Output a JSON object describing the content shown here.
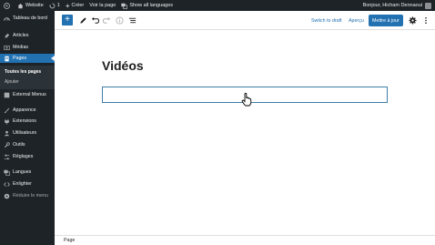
{
  "adminbar": {
    "site": "Website",
    "updates": "1",
    "create": "Créer",
    "view": "Voir la page",
    "languages": "Show all languages",
    "greeting": "Bonjour, Hicham Dennaoui"
  },
  "sidebar": {
    "items": [
      {
        "label": "Tableau de bord",
        "icon": "dashboard-icon"
      },
      {
        "label": "Articles",
        "icon": "pin-icon"
      },
      {
        "label": "Médias",
        "icon": "media-icon"
      },
      {
        "label": "Pages",
        "icon": "pages-icon"
      },
      {
        "label": "External Menus",
        "icon": "menu-icon"
      },
      {
        "label": "Apparence",
        "icon": "brush-icon"
      },
      {
        "label": "Extensions",
        "icon": "plugin-icon"
      },
      {
        "label": "Utilisateurs",
        "icon": "users-icon"
      },
      {
        "label": "Outils",
        "icon": "tools-icon"
      },
      {
        "label": "Réglages",
        "icon": "settings-icon"
      },
      {
        "label": "Langues",
        "icon": "languages-icon"
      },
      {
        "label": "Enlighter",
        "icon": "code-icon"
      },
      {
        "label": "Réduire le menu",
        "icon": "collapse-icon"
      }
    ],
    "submenu": [
      "Toutes les pages",
      "Ajouter"
    ]
  },
  "toolbar": {
    "switch_draft": "Switch to draft",
    "preview": "Aperçu",
    "update": "Mettre à jour"
  },
  "editor": {
    "title": "Vidéos"
  },
  "footer": {
    "breadcrumb": "Page"
  },
  "colors": {
    "admin_dark": "#1d2327",
    "accent": "#2271b1",
    "block_border": "#3f7fa8"
  }
}
